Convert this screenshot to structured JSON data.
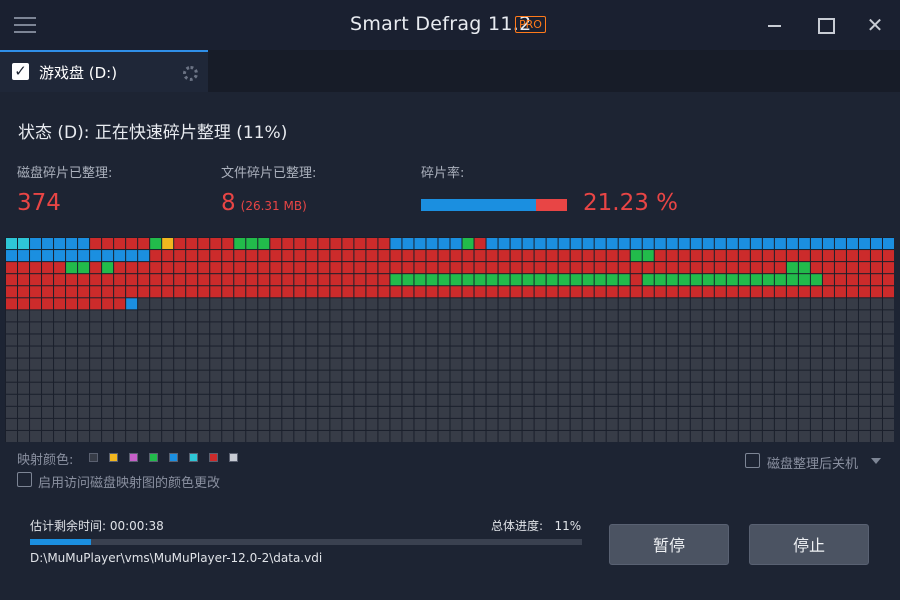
{
  "window": {
    "title": "Smart Defrag 11.2",
    "badge": "PRO",
    "close_glyph": "✕"
  },
  "tab": {
    "label": "游戏盘 (D:)",
    "checked": true,
    "check_glyph": "✓"
  },
  "status": {
    "text": "状态 (D): 正在快速碎片整理 (11%)"
  },
  "stats": {
    "disk_fragments_label": "磁盘碎片已整理:",
    "disk_fragments_value": "374",
    "file_fragments_label": "文件碎片已整理:",
    "file_fragments_value": "8",
    "file_fragments_size": "(26.31 MB)",
    "frag_rate_label": "碎片率:",
    "frag_rate_value": "21.23 %",
    "frag_rate_fraction": 0.2123
  },
  "block_map": {
    "columns": 74,
    "rows": 17,
    "palette": {
      "empty": "#373c47",
      "contiguous": "#1b8fe0",
      "fragmented": "#cc2b2b",
      "defragmented": "#22bb4b",
      "system": "#f2b71f",
      "light": "#2ec6d6"
    },
    "runs": [
      [
        "light",
        2
      ],
      [
        "contiguous",
        5
      ],
      [
        "fragmented",
        5
      ],
      [
        "defragmented",
        1
      ],
      [
        "system",
        1
      ],
      [
        "fragmented",
        5
      ],
      [
        "defragmented",
        3
      ],
      [
        "fragmented",
        10
      ],
      [
        "contiguous",
        6
      ],
      [
        "defragmented",
        1
      ],
      [
        "fragmented",
        1
      ],
      [
        "contiguous",
        34
      ],
      [
        "contiguous",
        12
      ],
      [
        "fragmented",
        40
      ],
      [
        "defragmented",
        2
      ],
      [
        "fragmented",
        20
      ],
      [
        "fragmented",
        5
      ],
      [
        "defragmented",
        2
      ],
      [
        "fragmented",
        1
      ],
      [
        "defragmented",
        1
      ],
      [
        "fragmented",
        56
      ],
      [
        "defragmented",
        2
      ],
      [
        "fragmented",
        7
      ],
      [
        "fragmented",
        32
      ],
      [
        "defragmented",
        20
      ],
      [
        "fragmented",
        1
      ],
      [
        "defragmented",
        15
      ],
      [
        "fragmented",
        6
      ],
      [
        "fragmented",
        74
      ],
      [
        "fragmented",
        10
      ],
      [
        "contiguous",
        1
      ],
      [
        "empty",
        1033
      ]
    ]
  },
  "legend": {
    "label": "映射颜色:",
    "swatches": [
      "#373c47",
      "#f2b71f",
      "#c65fc8",
      "#22bb4b",
      "#1b8fe0",
      "#2ec6d6",
      "#cc2b2b",
      "#c8ccd4"
    ]
  },
  "options": {
    "shutdown_label": "磁盘整理后关机",
    "shutdown_checked": false,
    "color_change_label": "启用访问磁盘映射图的颜色更改",
    "color_change_checked": false
  },
  "progress": {
    "eta_label": "估计剩余时间: 00:00:38",
    "total_label": "总体进度:",
    "total_value": "11%",
    "fraction": 0.11,
    "current_file": "D:\\MuMuPlayer\\vms\\MuMuPlayer-12.0-2\\data.vdi"
  },
  "buttons": {
    "pause": "暂停",
    "stop": "停止"
  }
}
